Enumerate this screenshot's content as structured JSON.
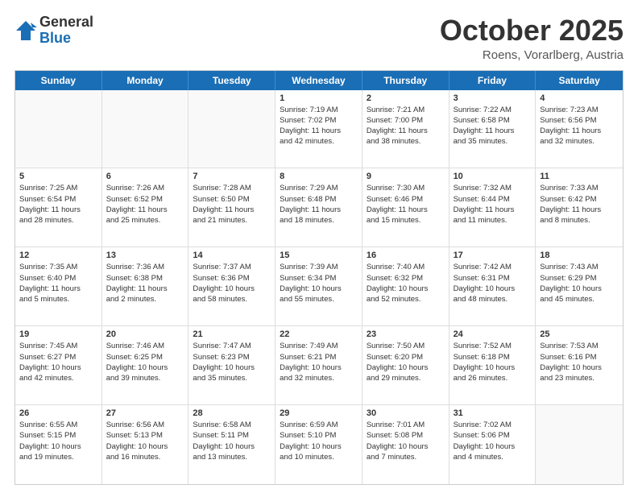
{
  "header": {
    "logo_general": "General",
    "logo_blue": "Blue",
    "month_title": "October 2025",
    "location": "Roens, Vorarlberg, Austria"
  },
  "days_of_week": [
    "Sunday",
    "Monday",
    "Tuesday",
    "Wednesday",
    "Thursday",
    "Friday",
    "Saturday"
  ],
  "weeks": [
    [
      {
        "day": "",
        "empty": true,
        "lines": []
      },
      {
        "day": "",
        "empty": true,
        "lines": []
      },
      {
        "day": "",
        "empty": true,
        "lines": []
      },
      {
        "day": "1",
        "lines": [
          "Sunrise: 7:19 AM",
          "Sunset: 7:02 PM",
          "Daylight: 11 hours",
          "and 42 minutes."
        ]
      },
      {
        "day": "2",
        "lines": [
          "Sunrise: 7:21 AM",
          "Sunset: 7:00 PM",
          "Daylight: 11 hours",
          "and 38 minutes."
        ]
      },
      {
        "day": "3",
        "lines": [
          "Sunrise: 7:22 AM",
          "Sunset: 6:58 PM",
          "Daylight: 11 hours",
          "and 35 minutes."
        ]
      },
      {
        "day": "4",
        "lines": [
          "Sunrise: 7:23 AM",
          "Sunset: 6:56 PM",
          "Daylight: 11 hours",
          "and 32 minutes."
        ]
      }
    ],
    [
      {
        "day": "5",
        "lines": [
          "Sunrise: 7:25 AM",
          "Sunset: 6:54 PM",
          "Daylight: 11 hours",
          "and 28 minutes."
        ]
      },
      {
        "day": "6",
        "lines": [
          "Sunrise: 7:26 AM",
          "Sunset: 6:52 PM",
          "Daylight: 11 hours",
          "and 25 minutes."
        ]
      },
      {
        "day": "7",
        "lines": [
          "Sunrise: 7:28 AM",
          "Sunset: 6:50 PM",
          "Daylight: 11 hours",
          "and 21 minutes."
        ]
      },
      {
        "day": "8",
        "lines": [
          "Sunrise: 7:29 AM",
          "Sunset: 6:48 PM",
          "Daylight: 11 hours",
          "and 18 minutes."
        ]
      },
      {
        "day": "9",
        "lines": [
          "Sunrise: 7:30 AM",
          "Sunset: 6:46 PM",
          "Daylight: 11 hours",
          "and 15 minutes."
        ]
      },
      {
        "day": "10",
        "lines": [
          "Sunrise: 7:32 AM",
          "Sunset: 6:44 PM",
          "Daylight: 11 hours",
          "and 11 minutes."
        ]
      },
      {
        "day": "11",
        "lines": [
          "Sunrise: 7:33 AM",
          "Sunset: 6:42 PM",
          "Daylight: 11 hours",
          "and 8 minutes."
        ]
      }
    ],
    [
      {
        "day": "12",
        "lines": [
          "Sunrise: 7:35 AM",
          "Sunset: 6:40 PM",
          "Daylight: 11 hours",
          "and 5 minutes."
        ]
      },
      {
        "day": "13",
        "lines": [
          "Sunrise: 7:36 AM",
          "Sunset: 6:38 PM",
          "Daylight: 11 hours",
          "and 2 minutes."
        ]
      },
      {
        "day": "14",
        "lines": [
          "Sunrise: 7:37 AM",
          "Sunset: 6:36 PM",
          "Daylight: 10 hours",
          "and 58 minutes."
        ]
      },
      {
        "day": "15",
        "lines": [
          "Sunrise: 7:39 AM",
          "Sunset: 6:34 PM",
          "Daylight: 10 hours",
          "and 55 minutes."
        ]
      },
      {
        "day": "16",
        "lines": [
          "Sunrise: 7:40 AM",
          "Sunset: 6:32 PM",
          "Daylight: 10 hours",
          "and 52 minutes."
        ]
      },
      {
        "day": "17",
        "lines": [
          "Sunrise: 7:42 AM",
          "Sunset: 6:31 PM",
          "Daylight: 10 hours",
          "and 48 minutes."
        ]
      },
      {
        "day": "18",
        "lines": [
          "Sunrise: 7:43 AM",
          "Sunset: 6:29 PM",
          "Daylight: 10 hours",
          "and 45 minutes."
        ]
      }
    ],
    [
      {
        "day": "19",
        "lines": [
          "Sunrise: 7:45 AM",
          "Sunset: 6:27 PM",
          "Daylight: 10 hours",
          "and 42 minutes."
        ]
      },
      {
        "day": "20",
        "lines": [
          "Sunrise: 7:46 AM",
          "Sunset: 6:25 PM",
          "Daylight: 10 hours",
          "and 39 minutes."
        ]
      },
      {
        "day": "21",
        "lines": [
          "Sunrise: 7:47 AM",
          "Sunset: 6:23 PM",
          "Daylight: 10 hours",
          "and 35 minutes."
        ]
      },
      {
        "day": "22",
        "lines": [
          "Sunrise: 7:49 AM",
          "Sunset: 6:21 PM",
          "Daylight: 10 hours",
          "and 32 minutes."
        ]
      },
      {
        "day": "23",
        "lines": [
          "Sunrise: 7:50 AM",
          "Sunset: 6:20 PM",
          "Daylight: 10 hours",
          "and 29 minutes."
        ]
      },
      {
        "day": "24",
        "lines": [
          "Sunrise: 7:52 AM",
          "Sunset: 6:18 PM",
          "Daylight: 10 hours",
          "and 26 minutes."
        ]
      },
      {
        "day": "25",
        "lines": [
          "Sunrise: 7:53 AM",
          "Sunset: 6:16 PM",
          "Daylight: 10 hours",
          "and 23 minutes."
        ]
      }
    ],
    [
      {
        "day": "26",
        "lines": [
          "Sunrise: 6:55 AM",
          "Sunset: 5:15 PM",
          "Daylight: 10 hours",
          "and 19 minutes."
        ]
      },
      {
        "day": "27",
        "lines": [
          "Sunrise: 6:56 AM",
          "Sunset: 5:13 PM",
          "Daylight: 10 hours",
          "and 16 minutes."
        ]
      },
      {
        "day": "28",
        "lines": [
          "Sunrise: 6:58 AM",
          "Sunset: 5:11 PM",
          "Daylight: 10 hours",
          "and 13 minutes."
        ]
      },
      {
        "day": "29",
        "lines": [
          "Sunrise: 6:59 AM",
          "Sunset: 5:10 PM",
          "Daylight: 10 hours",
          "and 10 minutes."
        ]
      },
      {
        "day": "30",
        "lines": [
          "Sunrise: 7:01 AM",
          "Sunset: 5:08 PM",
          "Daylight: 10 hours",
          "and 7 minutes."
        ]
      },
      {
        "day": "31",
        "lines": [
          "Sunrise: 7:02 AM",
          "Sunset: 5:06 PM",
          "Daylight: 10 hours",
          "and 4 minutes."
        ]
      },
      {
        "day": "",
        "empty": true,
        "lines": []
      }
    ]
  ]
}
